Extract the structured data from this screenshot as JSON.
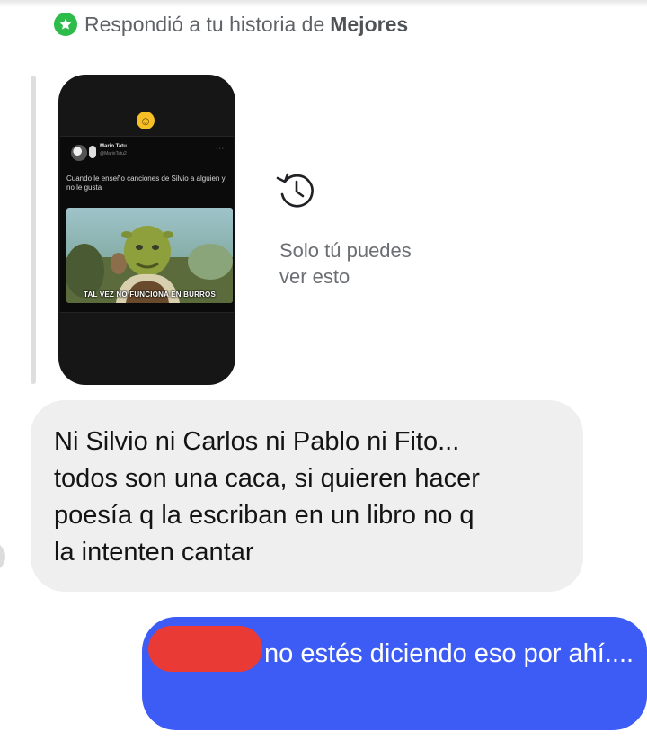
{
  "story_reply": {
    "prefix": "Respondió a tu historia de",
    "list_name": "Mejores",
    "badge_icon": "star-icon",
    "badge_color": "#2dbb4a"
  },
  "story_preview": {
    "emoji_icon": "grinning-sweat-emoji",
    "tweet": {
      "author_name": "Mario Tatu",
      "author_handle": "@MarioTatu2",
      "text": "Cuando le enseño canciones de Silvio a alguien y no le gusta",
      "meme_caption": "TAL VEZ NO FUNCIONA EN BURROS"
    }
  },
  "expired_notice": {
    "icon": "history-icon",
    "text": "Solo tú puedes\nver esto"
  },
  "messages": {
    "incoming": {
      "text": "Ni Silvio ni Carlos ni Pablo ni Fito...\ntodos son una caca, si quieren hacer\npoesía q la escriban en un libro no q\nla intenten cantar"
    },
    "outgoing": {
      "text": "no estés diciendo eso por ahí....",
      "redaction_color": "#e93a36"
    }
  },
  "colors": {
    "outgoing_bubble": "#3d5cf5",
    "incoming_bubble": "#efefef"
  }
}
